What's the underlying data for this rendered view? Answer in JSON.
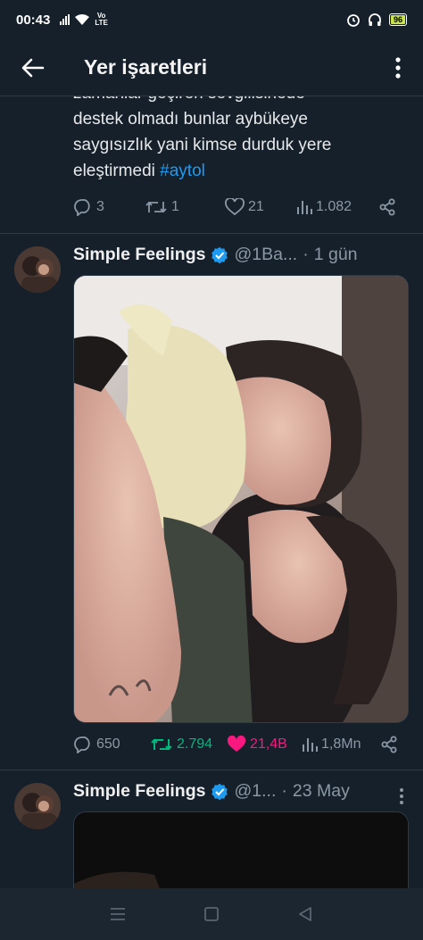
{
  "status_bar": {
    "time": "00:43",
    "network_label_top": "Vo",
    "network_label_bottom": "LTE",
    "battery": "96",
    "icons": [
      "signal-icon",
      "wifi-icon",
      "alarm-icon",
      "headphones-icon",
      "battery-icon"
    ]
  },
  "header": {
    "title": "Yer işaretleri",
    "back_icon": "arrow-left-icon",
    "more_icon": "vertical-dots-icon"
  },
  "tweet0": {
    "cut_line": "zamanlar geçiren sevgilisinede",
    "line1": "destek olmadı bunlar aybükeye",
    "line2": "saygısızlık yani kimse durduk yere",
    "line3_text": "eleştirmedi ",
    "hashtag": "#aytol",
    "replies": "3",
    "retweets": "1",
    "likes": "21",
    "views": "1.082"
  },
  "tweet1": {
    "name": "Simple Feelings",
    "handle": "@1Ba...",
    "time": "1 gün",
    "replies": "650",
    "retweets": "2.794",
    "likes": "21,4B",
    "views": "1,8Mn",
    "liked": true,
    "retweeted": true
  },
  "tweet2": {
    "name": "Simple Feelings",
    "handle": "@1...",
    "time": "23 May"
  },
  "colors": {
    "background": "#15202b",
    "accent_blue": "#1d9bf0",
    "retweet_green": "#00ba7c",
    "like_pink": "#f91880",
    "muted": "#8b98a5"
  }
}
